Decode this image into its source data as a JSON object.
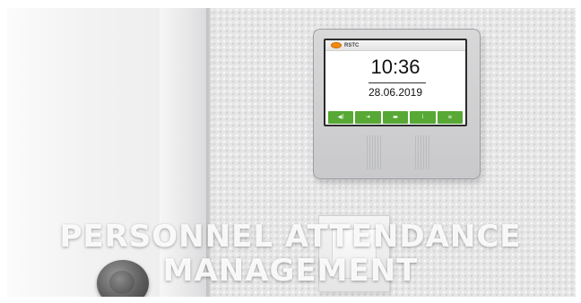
{
  "terminal": {
    "brand": "RSTC",
    "time": "10:36",
    "date": "28.06.2019",
    "buttons": [
      {
        "icon": "speaker-icon",
        "glyph": "◀)"
      },
      {
        "icon": "exit-arrow-icon",
        "glyph": "➜"
      },
      {
        "icon": "briefcase-icon",
        "glyph": "▬"
      },
      {
        "icon": "info-icon",
        "glyph": "i"
      },
      {
        "icon": "menu-icon",
        "glyph": "≡"
      }
    ],
    "accent_color": "#57a835",
    "logo_color": "#ef8a13"
  },
  "headline": {
    "line1": "PERSONNEL ATTENDANCE",
    "line2": "MANAGEMENT"
  }
}
